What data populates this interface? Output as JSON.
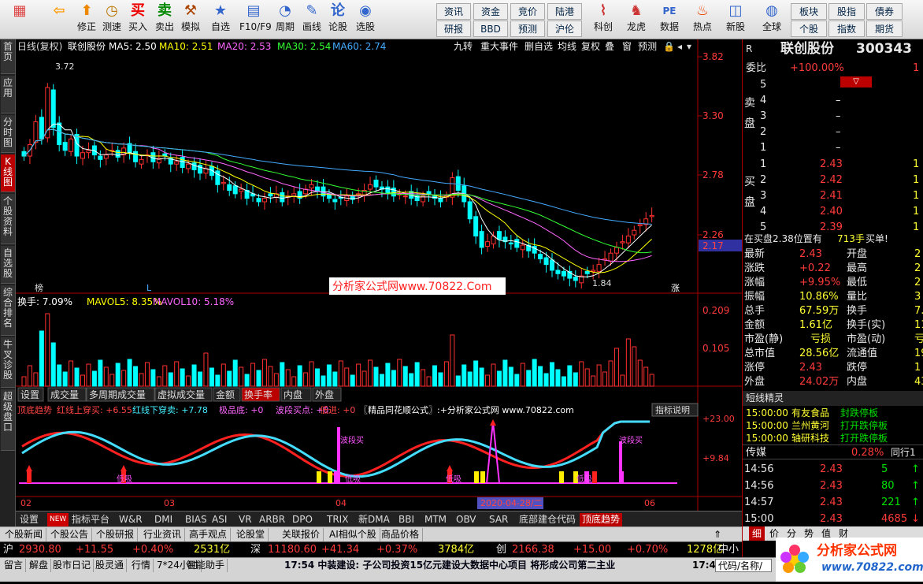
{
  "toolbar": {
    "big": [
      {
        "label": "",
        "icon": "grid-icon"
      },
      {
        "label": "",
        "icon": "back-arrow-icon"
      },
      {
        "label": "修正",
        "icon": "refresh-icon"
      },
      {
        "label": "测速",
        "icon": "clock-icon"
      },
      {
        "label": "买入",
        "icon": "buy-icon",
        "glyph": "买"
      },
      {
        "label": "卖出",
        "icon": "sell-icon",
        "glyph": "卖"
      },
      {
        "label": "模拟",
        "icon": "hammer-icon"
      },
      {
        "label": "自选",
        "icon": "star-icon"
      },
      {
        "label": "F10/F9",
        "icon": "f10-icon"
      },
      {
        "label": "周期",
        "icon": "period-icon"
      },
      {
        "label": "画线",
        "icon": "pen-icon"
      },
      {
        "label": "论股",
        "icon": "discuss-icon",
        "glyph": "论"
      },
      {
        "label": "选股",
        "icon": "select-icon"
      }
    ],
    "small": [
      "资讯",
      "资金",
      "竞价",
      "陆港",
      "研报",
      "BBD",
      "预测",
      "沪伦"
    ],
    "big2": [
      {
        "label": "科创",
        "icon": "kc-icon"
      },
      {
        "label": "龙虎",
        "icon": "dragon-icon"
      },
      {
        "label": "数据",
        "icon": "pe-icon"
      },
      {
        "label": "热点",
        "icon": "hot-icon"
      },
      {
        "label": "新股",
        "icon": "ipo-icon"
      },
      {
        "label": "全球",
        "icon": "globe-icon"
      }
    ],
    "small2": [
      "板块",
      "股指",
      "債券",
      "个股",
      "指数",
      "期货"
    ]
  },
  "left_tabs": [
    "首页",
    "应用",
    "分时图",
    "K线图",
    "个股资料",
    "自选股",
    "综合排名",
    "牛叉诊股",
    "超级盘口"
  ],
  "kline": {
    "header": "日线(复权)",
    "stock": "联创股份",
    "ma": [
      {
        "label": "MA5: 2.50",
        "color": "#ffffff"
      },
      {
        "label": "MA10: 2.51",
        "color": "#ffff00"
      },
      {
        "label": "MA20: 2.53",
        "color": "#ff66ff"
      },
      {
        "label": "MA30: 2.54",
        "color": "#33ff33"
      },
      {
        "label": "MA60: 2.74",
        "color": "#44aaff"
      }
    ],
    "tabs": [
      "九转",
      "重大事件",
      "删自选",
      "均线",
      "复权",
      "叠",
      "窗",
      "预测"
    ],
    "yticks": [
      "3.82",
      "3.30",
      "2.78",
      "2.26"
    ],
    "current": "2.17",
    "high_label": "3.72",
    "low_label": "1.84",
    "marks": [
      "榜",
      "L",
      "涨"
    ],
    "watermark": "分析家公式网www.70822.Com",
    "up": "#ff3030",
    "down": "#00ffff"
  },
  "volume": {
    "header": "换手: 7.09%",
    "mavol5": "MAVOL5: 8.35%",
    "mavol10": "MAVOL10: 5.18%",
    "yticks": [
      "0.209",
      "0.105"
    ],
    "tabs": [
      "设置",
      "成交量",
      "多周期成交量",
      "虚拟成交量",
      "金额",
      "换手率",
      "内盘",
      "外盘"
    ],
    "active_tab": "换手率"
  },
  "indicator": {
    "title": "顶底趋势",
    "items": [
      {
        "t": "红线上穿买: +6.55",
        "c": "#ff4444"
      },
      {
        "t": "红线下穿卖: +7.78",
        "c": "#44eeff"
      },
      {
        "t": "极品底: +0",
        "c": "#ff66ff"
      },
      {
        "t": "波段买点: +0",
        "c": "#ff66ff"
      },
      {
        "t": "低进: +0",
        "c": "#ff4444"
      }
    ],
    "source": "〖精品同花顺公式〗:+分析家公式网 www.70822.com",
    "explain": "指标说明",
    "yticks": [
      "+23.00",
      "+9.84"
    ],
    "labels": [
      "波段买",
      "低吸",
      "低吸",
      "低吸",
      "波段买",
      "低吸"
    ]
  },
  "xaxis": {
    "labels": [
      "02",
      "03",
      "04",
      "06"
    ],
    "cursor_date": "2020-04-28/二"
  },
  "bottom_tabs": [
    "设置",
    "NEW",
    "指标平台",
    "W&R",
    "DMI",
    "BIAS",
    "ASI",
    "VR",
    "ARBR",
    "DPO",
    "TRIX",
    "新DMA",
    "BBI",
    "MTM",
    "OBV",
    "SAR",
    "底部建仓代码",
    "顶底趋势"
  ],
  "info_tabs": [
    "个股新闻",
    "个股公告",
    "个股研报",
    "行业资讯",
    "高手观点",
    "论股堂",
    "关联报价",
    "AI相似个股",
    "商品价格"
  ],
  "indexes": {
    "sh": [
      "沪",
      "2930.80",
      "+11.55",
      "+0.40%",
      "2531亿"
    ],
    "sz": [
      "深",
      "11180.60",
      "+41.34",
      "+0.37%",
      "3784亿"
    ],
    "cy": [
      "创",
      "2166.38",
      "+15.00",
      "+0.70%",
      "1278亿"
    ],
    "tail": "中小"
  },
  "status": {
    "items": [
      "留言",
      "解盘",
      "股市日记",
      "股灵通",
      "行情",
      "7*24小时",
      "智能助手"
    ],
    "news": "17:54 中装建设: 子公司投资15亿元建设大数据中心项目 将形成公司第二主业",
    "time": "17:4",
    "search": "代码/名称/"
  },
  "quote": {
    "name": "联创股份",
    "code": "300343",
    "weibi_label": "委比",
    "weibi": "+100.00%",
    "weibi_n": "1",
    "sell_label": "卖盘",
    "sells": [
      {
        "lv": "5",
        "p": "",
        "v": ""
      },
      {
        "lv": "4",
        "p": "–",
        "v": ""
      },
      {
        "lv": "3",
        "p": "–",
        "v": ""
      },
      {
        "lv": "2",
        "p": "–",
        "v": ""
      },
      {
        "lv": "1",
        "p": "–",
        "v": ""
      }
    ],
    "buy_label": "买盘",
    "buys": [
      {
        "lv": "1",
        "p": "2.43",
        "v": "1"
      },
      {
        "lv": "2",
        "p": "2.42",
        "v": "1"
      },
      {
        "lv": "3",
        "p": "2.41",
        "v": "1"
      },
      {
        "lv": "4",
        "p": "2.40",
        "v": "1"
      },
      {
        "lv": "5",
        "p": "2.39",
        "v": "1"
      }
    ],
    "zaimai": "在买盘2.38位置有",
    "zaimai_v": "713手",
    "zaimai_t": "买单!",
    "stats": [
      [
        "最新",
        "2.43",
        "开盘",
        "2"
      ],
      [
        "涨跌",
        "+0.22",
        "最高",
        "2"
      ],
      [
        "涨幅",
        "+9.95%",
        "最低",
        "2"
      ],
      [
        "振幅",
        "10.86%",
        "量比",
        "3"
      ],
      [
        "总手",
        "67.59万",
        "换手",
        "7."
      ],
      [
        "金额",
        "1.61亿",
        "换手(实)",
        "11"
      ],
      [
        "市盈(静)",
        "亏损",
        "市盈(动)",
        "亏"
      ],
      [
        "总市值",
        "28.56亿",
        "流通值",
        "19"
      ],
      [
        "涨停",
        "2.43",
        "跌停",
        "1"
      ],
      [
        "外盘",
        "24.02万",
        "内盘",
        "43"
      ]
    ],
    "sprite_title": "短线精灵",
    "sprites": [
      [
        "15:00:00",
        "有友食品",
        "封跌停板"
      ],
      [
        "15:00:00",
        "兰州黄河",
        "打开跌停板"
      ],
      [
        "15:00:00",
        "轴研科技",
        "打开跌停板"
      ]
    ],
    "sector": [
      "传媒",
      "0.28%",
      "同行1"
    ],
    "ticks": [
      [
        "14:56",
        "2.43",
        "5"
      ],
      [
        "14:56",
        "2.43",
        "80"
      ],
      [
        "14:57",
        "2.43",
        "221"
      ],
      [
        "15:00",
        "2.43",
        "4685"
      ]
    ],
    "bottom_tabs": [
      "细",
      "价",
      "分",
      "势",
      "值",
      "财"
    ]
  },
  "logo": {
    "cn": "分析家公式网",
    "url": "www.70822.com"
  }
}
